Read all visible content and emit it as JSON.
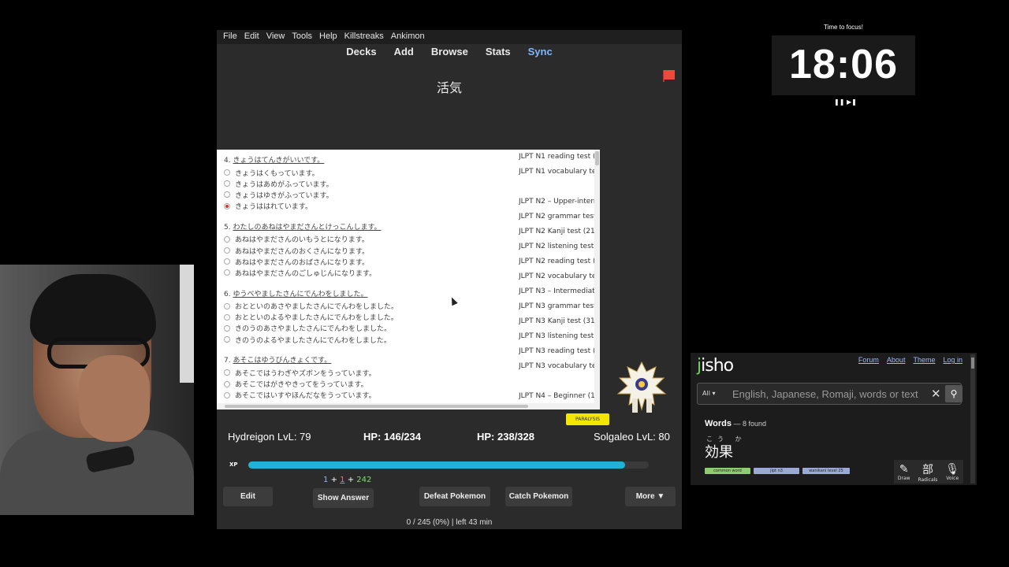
{
  "anki": {
    "menu": [
      "File",
      "Edit",
      "View",
      "Tools",
      "Help",
      "Killstreaks",
      "Ankimon"
    ],
    "toolbar": [
      "Decks",
      "Add",
      "Browse",
      "Stats",
      "Sync"
    ],
    "card_front": "活気",
    "questions": [
      {
        "title_num": "4. ",
        "title": "きょうはてんきがいいです。",
        "options": [
          "きょうはくもっています。",
          "きょうはあめがふっています。",
          "きょうはゆきがふっています。",
          "きょうははれています。"
        ],
        "selected": 3
      },
      {
        "title_num": "5. ",
        "title": "わたしのあねはやまださんとけっこんします。",
        "options": [
          "あねはやまださんのいもうとになります。",
          "あねはやまださんのおくさんになります。",
          "あねはやまださんのおばさんになります。",
          "あねはやまださんのごしゅじんになります。"
        ],
        "selected": -1
      },
      {
        "title_num": "6. ",
        "title": "ゆうべやましたさんにでんわをしました。",
        "options": [
          "おとといのあさやましたさんにでんわをしました。",
          "おとといのよるやましたさんにでんわをしました。",
          "きのうのあさやましたさんにでんわをしました。",
          "きのうのよるやましたさんにでんわをしました。"
        ],
        "selected": -1
      },
      {
        "title_num": "7. ",
        "title": "あそこはゆうびんきょくです。",
        "options": [
          "あそこではうわぎやズボンをうっています。",
          "あそこではがきやきってをうっています。",
          "あそこではいすやほんだなをうっています。"
        ],
        "selected": -1
      }
    ],
    "side_links": [
      "JLPT N1 reading test (5",
      "JLPT N1 vocabulary tes",
      "",
      "JLPT N2 – Upper-interm",
      "JLPT N2 grammar test (",
      "JLPT N2 Kanji test (21)",
      "JLPT N2 listening test (3",
      "JLPT N2 reading test (4",
      "JLPT N2 vocabulary tes",
      "JLPT N3 – Intermediate",
      "JLPT N3 grammar test (",
      "JLPT N3 Kanji test (31)",
      "JLPT N3 listening test (2",
      "JLPT N3 reading test (1",
      "JLPT N3 vocabulary tes",
      "",
      "JLPT N4 – Beginner (15"
    ],
    "status_badge": "PARALYSIS",
    "player": "Hydreigon LvL: 79",
    "player_hp": "HP: 146/234",
    "enemy_hp": "HP: 238/328",
    "enemy": "Solgaleo LvL: 80",
    "xp_label": "XP",
    "xp_fraction": 0.94,
    "counts": {
      "new": "1",
      "plus1": "+",
      "learn": "1",
      "plus2": "+",
      "review": "242"
    },
    "buttons": {
      "edit": "Edit",
      "show_answer": "Show Answer",
      "defeat": "Defeat Pokemon",
      "catch": "Catch Pokemon",
      "more": "More ▼"
    },
    "status_line": "0 / 245 (0%) | left 43 min",
    "colors": {
      "xp_bar": "#1fb4d6",
      "flag": "#e74c3c",
      "badge": "#f3e600"
    }
  },
  "timer": {
    "title": "Time to focus!",
    "value": "18:06",
    "controls": "❚❚ ▶❚"
  },
  "jisho": {
    "logo": "jisho",
    "nav": [
      "Forum",
      "About",
      "Theme",
      "Log in"
    ],
    "search_scope": "All ▾",
    "search_placeholder": "English, Japanese, Romaji, words or text",
    "words_heading": "Words",
    "words_found": " — 8 found",
    "furigana": "こう か",
    "word": "効果",
    "tags": [
      "common word",
      "jlpt n3",
      "wanikani level 25"
    ],
    "tools": [
      {
        "glyph": "✎",
        "label": "Draw"
      },
      {
        "glyph": "部",
        "label": "Radicals"
      },
      {
        "glyph": "🎙",
        "label": "Voice"
      }
    ],
    "colors": {
      "logo_accent": "#6ed35a",
      "tag_common": "#8ccd6e",
      "tag_other": "#9ba9d6"
    }
  }
}
